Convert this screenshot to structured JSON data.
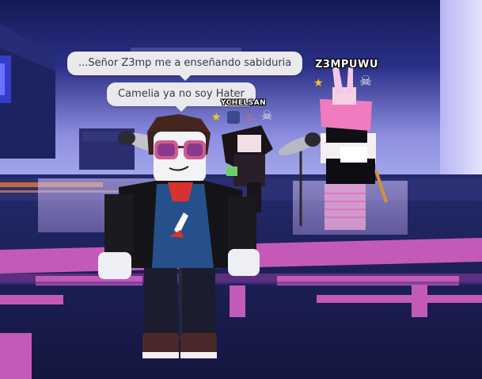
{
  "chat": {
    "bubble_1": "...Señor Z3mp me a enseñando sabiduria",
    "bubble_2": "Camelia ya no soy Hater"
  },
  "nametags": {
    "player_right": "Z3MPUWU",
    "player_middle": "YCHELSAN"
  },
  "badges": {
    "player_right": [
      "star-badge-icon",
      "skull-badge-icon"
    ],
    "player_middle": [
      "star-badge-icon",
      "dance-badge-icon",
      "fire-badge-icon",
      "skull-badge-icon"
    ]
  },
  "colors": {
    "sky_top": "#1a1f5e",
    "sky_glow": "#8a8ee0",
    "floor_neon": "#c45ab8",
    "floor_dark": "#1c1c5a",
    "chat_bubble": "#e9e9ee",
    "chat_text": "#3a3a48"
  }
}
